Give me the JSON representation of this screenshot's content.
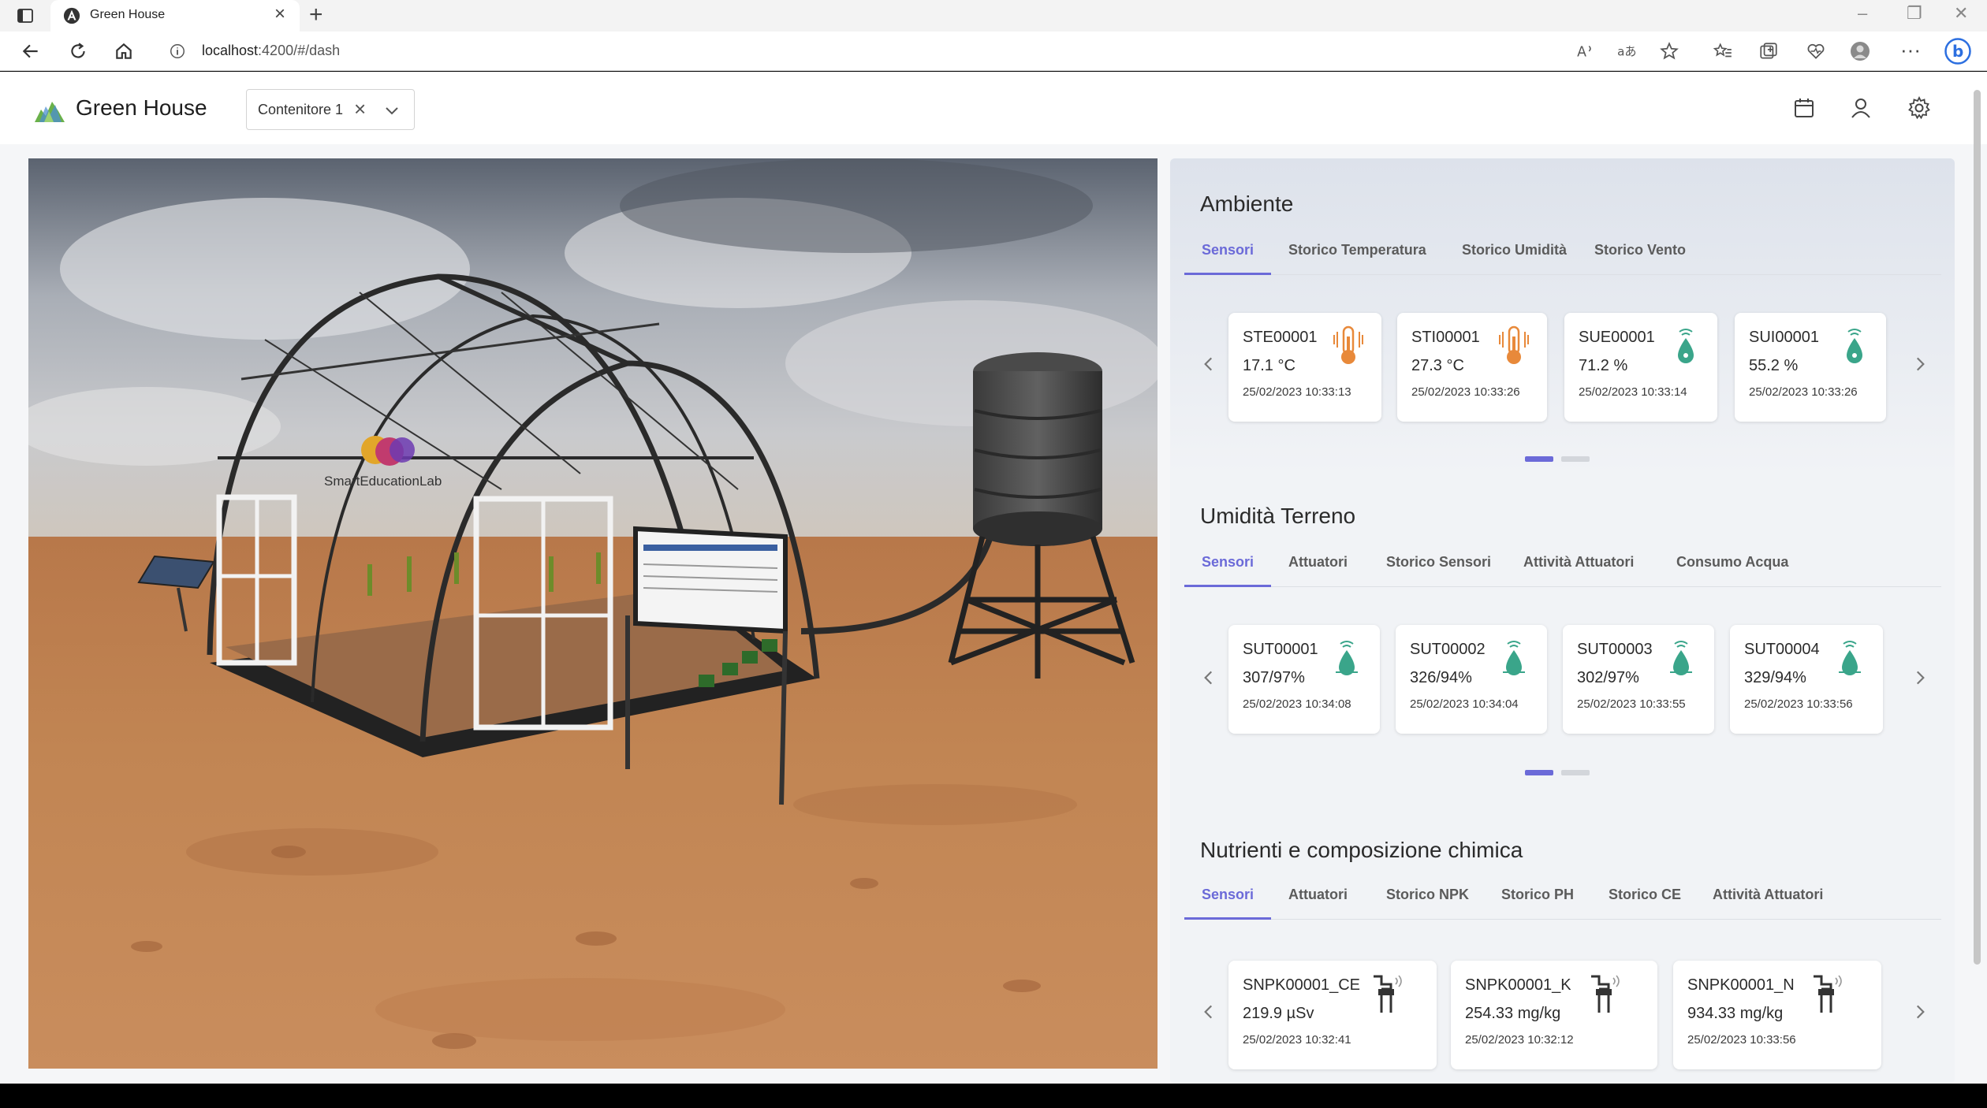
{
  "browser": {
    "tab_title": "Green House",
    "url_host": "localhost",
    "url_path": ":4200/#/dash"
  },
  "app": {
    "title": "Green House",
    "container_select": {
      "value": "Contenitore 1"
    }
  },
  "ambiente": {
    "title": "Ambiente",
    "tabs": [
      "Sensori",
      "Storico Temperatura",
      "Storico Umidità",
      "Storico Vento"
    ],
    "active_tab": 0,
    "cards": [
      {
        "id": "STE00001",
        "value": "17.1 °C",
        "time": "25/02/2023 10:33:13",
        "icon": "thermometer-icon"
      },
      {
        "id": "STI00001",
        "value": "27.3 °C",
        "time": "25/02/2023 10:33:26",
        "icon": "thermometer-icon"
      },
      {
        "id": "SUE00001",
        "value": "71.2 %",
        "time": "25/02/2023 10:33:14",
        "icon": "humidity-sensor-icon"
      },
      {
        "id": "SUI00001",
        "value": "55.2 %",
        "time": "25/02/2023 10:33:26",
        "icon": "humidity-sensor-icon"
      }
    ],
    "page": 1,
    "pages": 2
  },
  "umidita": {
    "title": "Umidità Terreno",
    "tabs": [
      "Sensori",
      "Attuatori",
      "Storico Sensori",
      "Attività Attuatori",
      "Consumo Acqua"
    ],
    "active_tab": 0,
    "cards": [
      {
        "id": "SUT00001",
        "value": "307/97%",
        "time": "25/02/2023 10:34:08",
        "icon": "soil-moisture-icon"
      },
      {
        "id": "SUT00002",
        "value": "326/94%",
        "time": "25/02/2023 10:34:04",
        "icon": "soil-moisture-icon"
      },
      {
        "id": "SUT00003",
        "value": "302/97%",
        "time": "25/02/2023 10:33:55",
        "icon": "soil-moisture-icon"
      },
      {
        "id": "SUT00004",
        "value": "329/94%",
        "time": "25/02/2023 10:33:56",
        "icon": "soil-moisture-icon"
      }
    ],
    "page": 1,
    "pages": 2
  },
  "nutrienti": {
    "title": "Nutrienti e composizione chimica",
    "tabs": [
      "Sensori",
      "Attuatori",
      "Storico NPK",
      "Storico PH",
      "Storico CE",
      "Attività Attuatori"
    ],
    "active_tab": 0,
    "cards": [
      {
        "id": "SNPK00001_CE",
        "value": "219.9 µSv",
        "time": "25/02/2023 10:32:41",
        "icon": "soil-probe-icon"
      },
      {
        "id": "SNPK00001_K",
        "value": "254.33 mg/kg",
        "time": "25/02/2023 10:32:12",
        "icon": "soil-probe-icon"
      },
      {
        "id": "SNPK00001_N",
        "value": "934.33 mg/kg",
        "time": "25/02/2023 10:33:56",
        "icon": "soil-probe-icon"
      }
    ]
  },
  "scene": {
    "sign_text": "SmartEducationLab"
  },
  "colors": {
    "accent": "#6b6ad8",
    "sensor_icon": "#3aa58a",
    "thermo_icon": "#e8893a"
  }
}
